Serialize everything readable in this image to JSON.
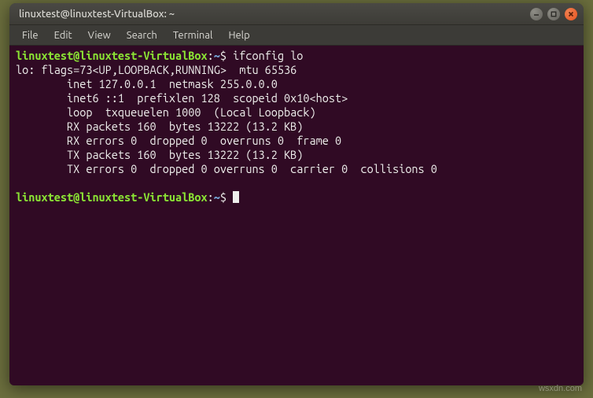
{
  "window": {
    "title": "linuxtest@linuxtest-VirtualBox: ~"
  },
  "menubar": {
    "items": [
      "File",
      "Edit",
      "View",
      "Search",
      "Terminal",
      "Help"
    ]
  },
  "terminal": {
    "prompt_user": "linuxtest@linuxtest-VirtualBox",
    "prompt_colon": ":",
    "prompt_path": "~",
    "prompt_dollar": "$ ",
    "command1": "ifconfig lo",
    "output_lines": [
      "lo: flags=73<UP,LOOPBACK,RUNNING>  mtu 65536",
      "        inet 127.0.0.1  netmask 255.0.0.0",
      "        inet6 ::1  prefixlen 128  scopeid 0x10<host>",
      "        loop  txqueuelen 1000  (Local Loopback)",
      "        RX packets 160  bytes 13222 (13.2 KB)",
      "        RX errors 0  dropped 0  overruns 0  frame 0",
      "        TX packets 160  bytes 13222 (13.2 KB)",
      "        TX errors 0  dropped 0 overruns 0  carrier 0  collisions 0"
    ]
  },
  "watermark": "wsxdn.com"
}
